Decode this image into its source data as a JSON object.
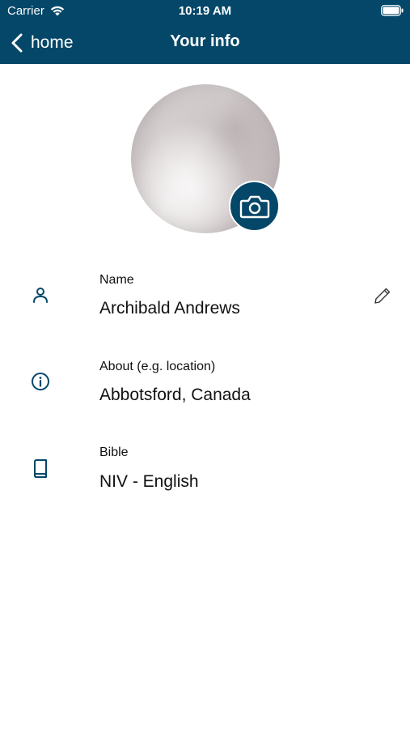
{
  "status_bar": {
    "carrier": "Carrier",
    "time": "10:19 AM"
  },
  "nav": {
    "back_label": "home",
    "title": "Your info"
  },
  "fields": [
    {
      "label": "Name",
      "value": "Archibald Andrews",
      "icon": "person-icon",
      "editable": true
    },
    {
      "label": "About (e.g. location)",
      "value": "Abbotsford, Canada",
      "icon": "info-icon"
    },
    {
      "label": "Bible",
      "value": "NIV - English",
      "icon": "book-icon"
    }
  ],
  "colors": {
    "brand": "#044769",
    "background": "#ffffff",
    "text": "#111111"
  }
}
